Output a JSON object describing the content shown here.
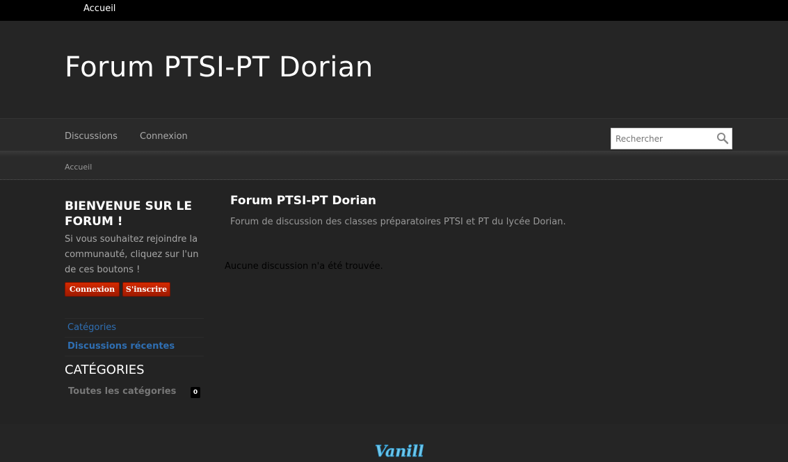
{
  "topbar": {
    "home_link": "Accueil"
  },
  "header": {
    "site_title": "Forum PTSI-PT Dorian"
  },
  "menu": {
    "items": [
      "Discussions",
      "Connexion"
    ],
    "search_placeholder": "Rechercher"
  },
  "breadcrumb": {
    "home": "Accueil"
  },
  "sidebar": {
    "welcome_title": "BIENVENUE SUR LE FORUM !",
    "welcome_text": "Si vous souhaitez rejoindre la communauté, cliquez sur l'un de ces boutons !",
    "buttons": {
      "login": "Connexion",
      "register": "S'inscrire"
    },
    "nav": [
      "Catégories",
      "Discussions récentes"
    ],
    "categories_heading": "CATÉGORIES",
    "categories": [
      {
        "label": "Toutes les catégories",
        "count": "0"
      }
    ]
  },
  "main": {
    "title": "Forum PTSI-PT Dorian",
    "description": "Forum de discussion des classes préparatoires PTSI et PT du lycée Dorian.",
    "empty_message": "Aucune discussion n'a été trouvée."
  },
  "footer": {
    "logo_text": "Vanilla"
  },
  "colors": {
    "accent_link": "#2f6fb3",
    "button_red": "#c22400",
    "background": "#232323"
  }
}
